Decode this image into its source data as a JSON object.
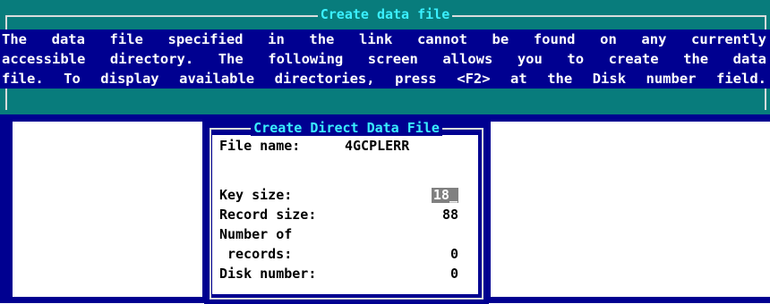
{
  "info_panel": {
    "title": "Create data file",
    "lines": [
      "The data file specified in the link cannot be found on any currently",
      "accessible directory. The following screen allows you to create the data",
      "file. To display available directories, press <F2> at the Disk number field."
    ]
  },
  "dialog": {
    "title": "Create Direct Data File",
    "file_name_label": "File name:",
    "file_name_value": "4GCPLERR",
    "key_size_label": "Key size:",
    "key_size_value": "18_",
    "record_size_label": "Record size:",
    "record_size_value": "88",
    "number_of_label": "Number of",
    "records_label": "records:",
    "records_value": "0",
    "disk_number_label": "Disk number:",
    "disk_number_value": "0"
  },
  "colors": {
    "teal_panel": "#087c7c",
    "navy": "#000090",
    "title_cyan": "#3af0ff",
    "frame": "#d8dcdc",
    "input_highlight": "#808080"
  }
}
